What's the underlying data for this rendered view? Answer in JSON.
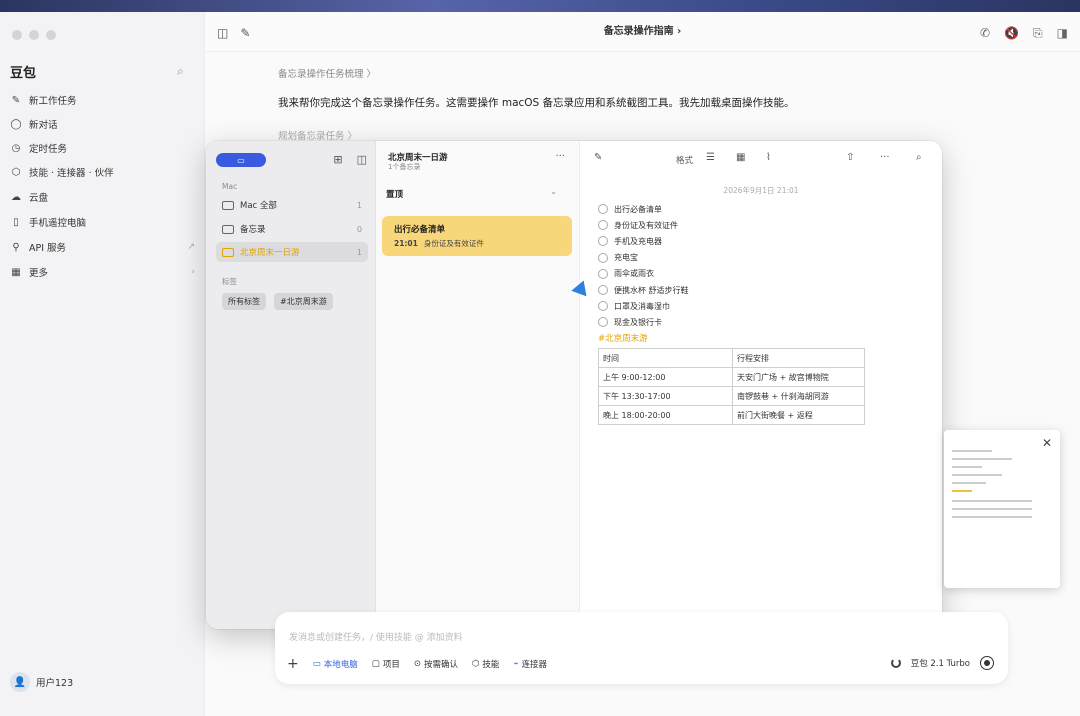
{
  "app": {
    "brand": "豆包",
    "window_title": "备忘录操作指南"
  },
  "sidebar": {
    "items": [
      {
        "label": "新工作任务",
        "icon": "edit-icon"
      },
      {
        "label": "新对话",
        "icon": "chat-icon"
      },
      {
        "label": "定时任务",
        "icon": "clock-icon"
      },
      {
        "label": "技能 · 连接器 · 伙伴",
        "icon": "skill-icon"
      },
      {
        "label": "云盘",
        "icon": "cloud-icon"
      },
      {
        "label": "手机遥控电脑",
        "icon": "phone-icon"
      },
      {
        "label": "API 服务",
        "icon": "api-icon",
        "trail": "↗"
      },
      {
        "label": "更多",
        "icon": "grid-icon",
        "trail": "›"
      }
    ],
    "user": "用户123"
  },
  "chat": {
    "breadcrumb": "备忘录操作任务梳理 〉",
    "message": "我来帮你完成这个备忘录操作任务。这需要操作 macOS 备忘录应用和系统截图工具。我先加载桌面操作技能。",
    "breadcrumb2": "规划备忘录任务 〉"
  },
  "notes": {
    "sidebar": {
      "section_mac": "Mac",
      "folders": [
        {
          "label": "Mac 全部",
          "count": "1"
        },
        {
          "label": "备忘录",
          "count": "0"
        },
        {
          "label": "北京周末一日游",
          "count": "1",
          "active": true
        }
      ],
      "section_tags": "标签",
      "tags": [
        "所有标签",
        "#北京周末游"
      ]
    },
    "list": {
      "title": "北京周末一日游",
      "subtitle": "1个备忘录",
      "pinned": "置顶",
      "card_title": "出行必备清单",
      "card_time": "21:01",
      "card_preview": "身份证及有效证件"
    },
    "editor": {
      "format_label": "格式",
      "date": "2026年9月1日 21:01",
      "checklist": [
        "出行必备清单",
        "身份证及有效证件",
        "手机及充电器",
        "充电宝",
        "雨伞或雨衣",
        "便携水杯 舒适步行鞋",
        "口罩及消毒湿巾",
        "现金及银行卡"
      ],
      "hashtag": "#北京周末游",
      "table_header": [
        "时间",
        "行程安排"
      ],
      "table_rows": [
        [
          "上午 9:00-12:00",
          "天安门广场 + 故宫博物院"
        ],
        [
          "下午 13:30-17:00",
          "南锣鼓巷 + 什刹海胡同游"
        ],
        [
          "晚上 18:00-20:00",
          "前门大街晚餐 + 返程"
        ]
      ]
    }
  },
  "input": {
    "placeholder": "发消息或创建任务，/ 使用技能 @ 添加资料",
    "chips": [
      "本地电脑",
      "项目",
      "按需确认",
      "技能",
      "连接器"
    ],
    "model": "豆包 2.1 Turbo"
  }
}
